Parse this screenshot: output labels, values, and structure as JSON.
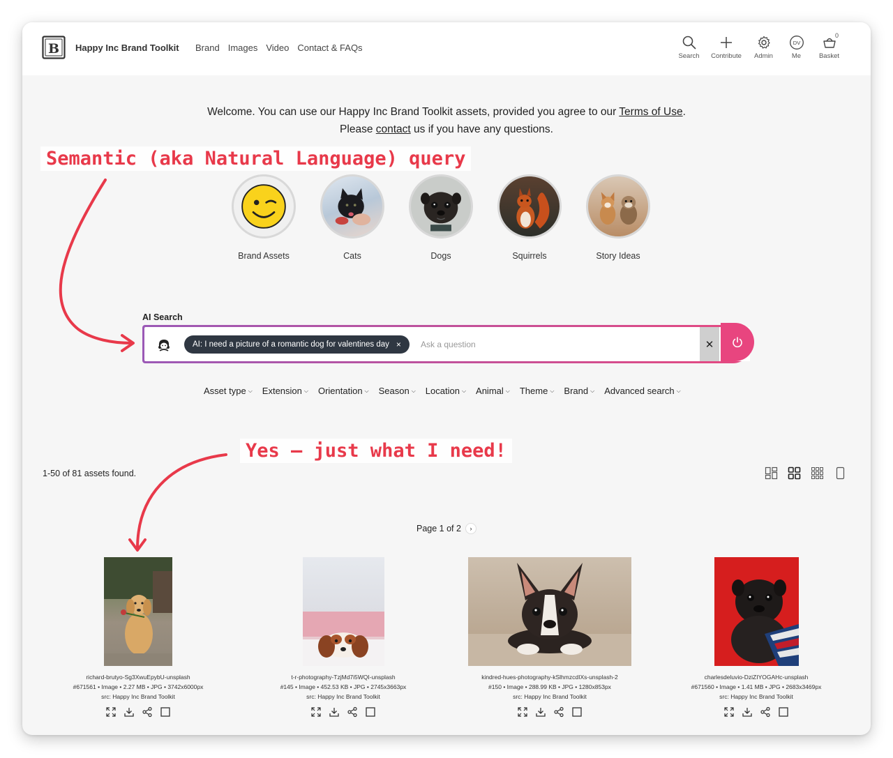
{
  "header": {
    "brand_name": "Happy Inc Brand Toolkit",
    "nav": [
      "Brand",
      "Images",
      "Video",
      "Contact & FAQs"
    ],
    "icons": [
      {
        "name": "search-icon",
        "label": "Search"
      },
      {
        "name": "plus-icon",
        "label": "Contribute"
      },
      {
        "name": "gear-icon",
        "label": "Admin"
      },
      {
        "name": "user-initials-icon",
        "label": "Me",
        "initials": "DV"
      },
      {
        "name": "basket-icon",
        "label": "Basket",
        "count": "0"
      }
    ]
  },
  "welcome": {
    "line1_pre": "Welcome. You can use our Happy Inc Brand Toolkit assets, provided you agree to our ",
    "terms_link": "Terms of Use",
    "line1_post": ".",
    "line2_pre": "Please ",
    "contact_link": "contact",
    "line2_post": " us if you have any questions."
  },
  "annotations": {
    "top": "Semantic (aka Natural Language) query",
    "bottom": "Yes – just what I need!",
    "color": "#e8394a"
  },
  "categories": [
    {
      "label": "Brand Assets"
    },
    {
      "label": "Cats"
    },
    {
      "label": "Dogs"
    },
    {
      "label": "Squirrels"
    },
    {
      "label": "Story Ideas"
    }
  ],
  "ai_search": {
    "label": "AI Search",
    "chip_text": "AI: I need a picture of a romantic dog for valentines day",
    "chip_close": "×",
    "placeholder": "Ask a question",
    "clear": "✕",
    "accent_start": "#9b59b6",
    "accent_end": "#e64980"
  },
  "filters": [
    "Asset type",
    "Extension",
    "Orientation",
    "Season",
    "Location",
    "Animal",
    "Theme",
    "Brand",
    "Advanced search"
  ],
  "results_summary": "1-50 of 81 assets found.",
  "pager": {
    "text": "Page 1 of 2",
    "next": "›"
  },
  "results": [
    {
      "title": "richard-brutyo-Sg3XwuEpybU-unsplash",
      "info": "#671561 • Image • 2.27 MB • JPG • 3742x6000px",
      "src": "src: Happy Inc Brand Toolkit"
    },
    {
      "title": "t-r-photography-TzjMd7i5WQI-unsplash",
      "info": "#145 • Image • 452.53 KB • JPG • 2745x3663px",
      "src": "src: Happy Inc Brand Toolkit"
    },
    {
      "title": "kindred-hues-photography-kSlhmzcdIXs-unsplash-2",
      "info": "#150 • Image • 288.99 KB • JPG • 1280x853px",
      "src": "src: Happy Inc Brand Toolkit"
    },
    {
      "title": "charlesdeluvio-DziZIYOGAHc-unsplash",
      "info": "#671560 • Image • 1.41 MB • JPG • 2683x3469px",
      "src": "src: Happy Inc Brand Toolkit"
    }
  ]
}
